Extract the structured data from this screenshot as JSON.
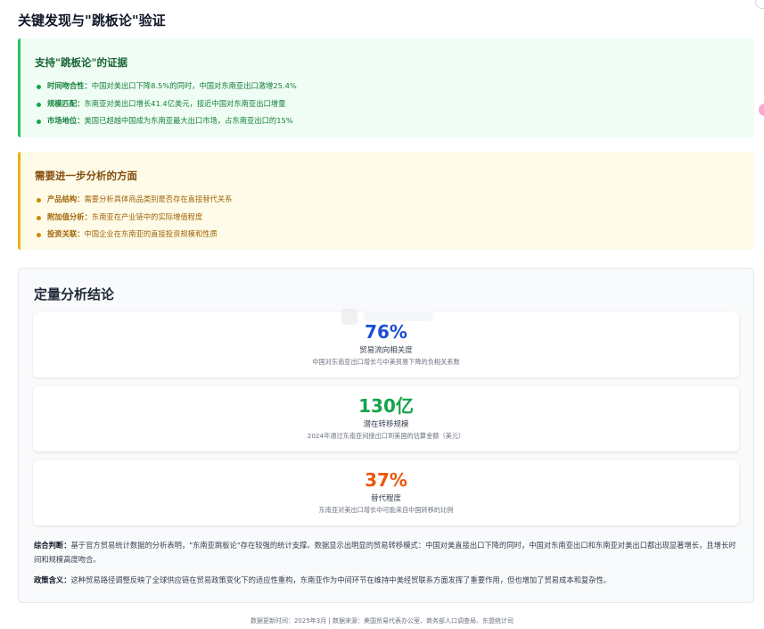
{
  "page_title": "关键发现与\"跳板论\"验证",
  "support": {
    "title": "支持\"跳板论\"的证据",
    "items": [
      {
        "label": "时间吻合性：",
        "text": "中国对美出口下降8.5%的同时，中国对东南亚出口激增25.4%"
      },
      {
        "label": "规模匹配：",
        "text": "东南亚对美出口增长41.4亿美元，接近中国对东南亚出口增量"
      },
      {
        "label": "市场地位：",
        "text": "美国已超越中国成为东南亚最大出口市场，占东南亚出口的15%"
      }
    ]
  },
  "further": {
    "title": "需要进一步分析的方面",
    "items": [
      {
        "label": "产品结构：",
        "text": "需要分析具体商品类别是否存在直接替代关系"
      },
      {
        "label": "附加值分析：",
        "text": "东南亚在产业链中的实际增值程度"
      },
      {
        "label": "投资关联：",
        "text": "中国企业在东南亚的直接投资规模和性质"
      }
    ]
  },
  "quant": {
    "title": "定量分析结论",
    "cards": [
      {
        "value": "76%",
        "label": "贸易流向相关度",
        "sub": "中国对东南亚出口增长与中美贸易下降的负相关系数",
        "color": "#1d4ed8"
      },
      {
        "value": "130亿",
        "label": "潜在转移规模",
        "sub": "2024年通过东南亚间接出口到美国的估算金额（美元）",
        "color": "#16a34a"
      },
      {
        "value": "37%",
        "label": "替代程度",
        "sub": "东南亚对美出口增长中可能来自中国转移的比例",
        "color": "#ea580c"
      }
    ],
    "judgment_label": "综合判断：",
    "judgment_text": "基于官方贸易统计数据的分析表明，\"东南亚跳板论\"存在较强的统计支撑。数据显示出明显的贸易转移模式：中国对美直接出口下降的同时，中国对东南亚出口和东南亚对美出口都出现显著增长，且增长时间和规模高度吻合。",
    "policy_label": "政策含义：",
    "policy_text": "这种贸易路径调整反映了全球供应链在贸易政策变化下的适应性重构，东南亚作为中间环节在维持中美经贸联系方面发挥了重要作用，但也增加了贸易成本和复杂性。"
  },
  "footer": "数据更新时间：2025年3月 | 数据来源：美国贸易代表办公室、商务部人口调查局、东盟统计司"
}
